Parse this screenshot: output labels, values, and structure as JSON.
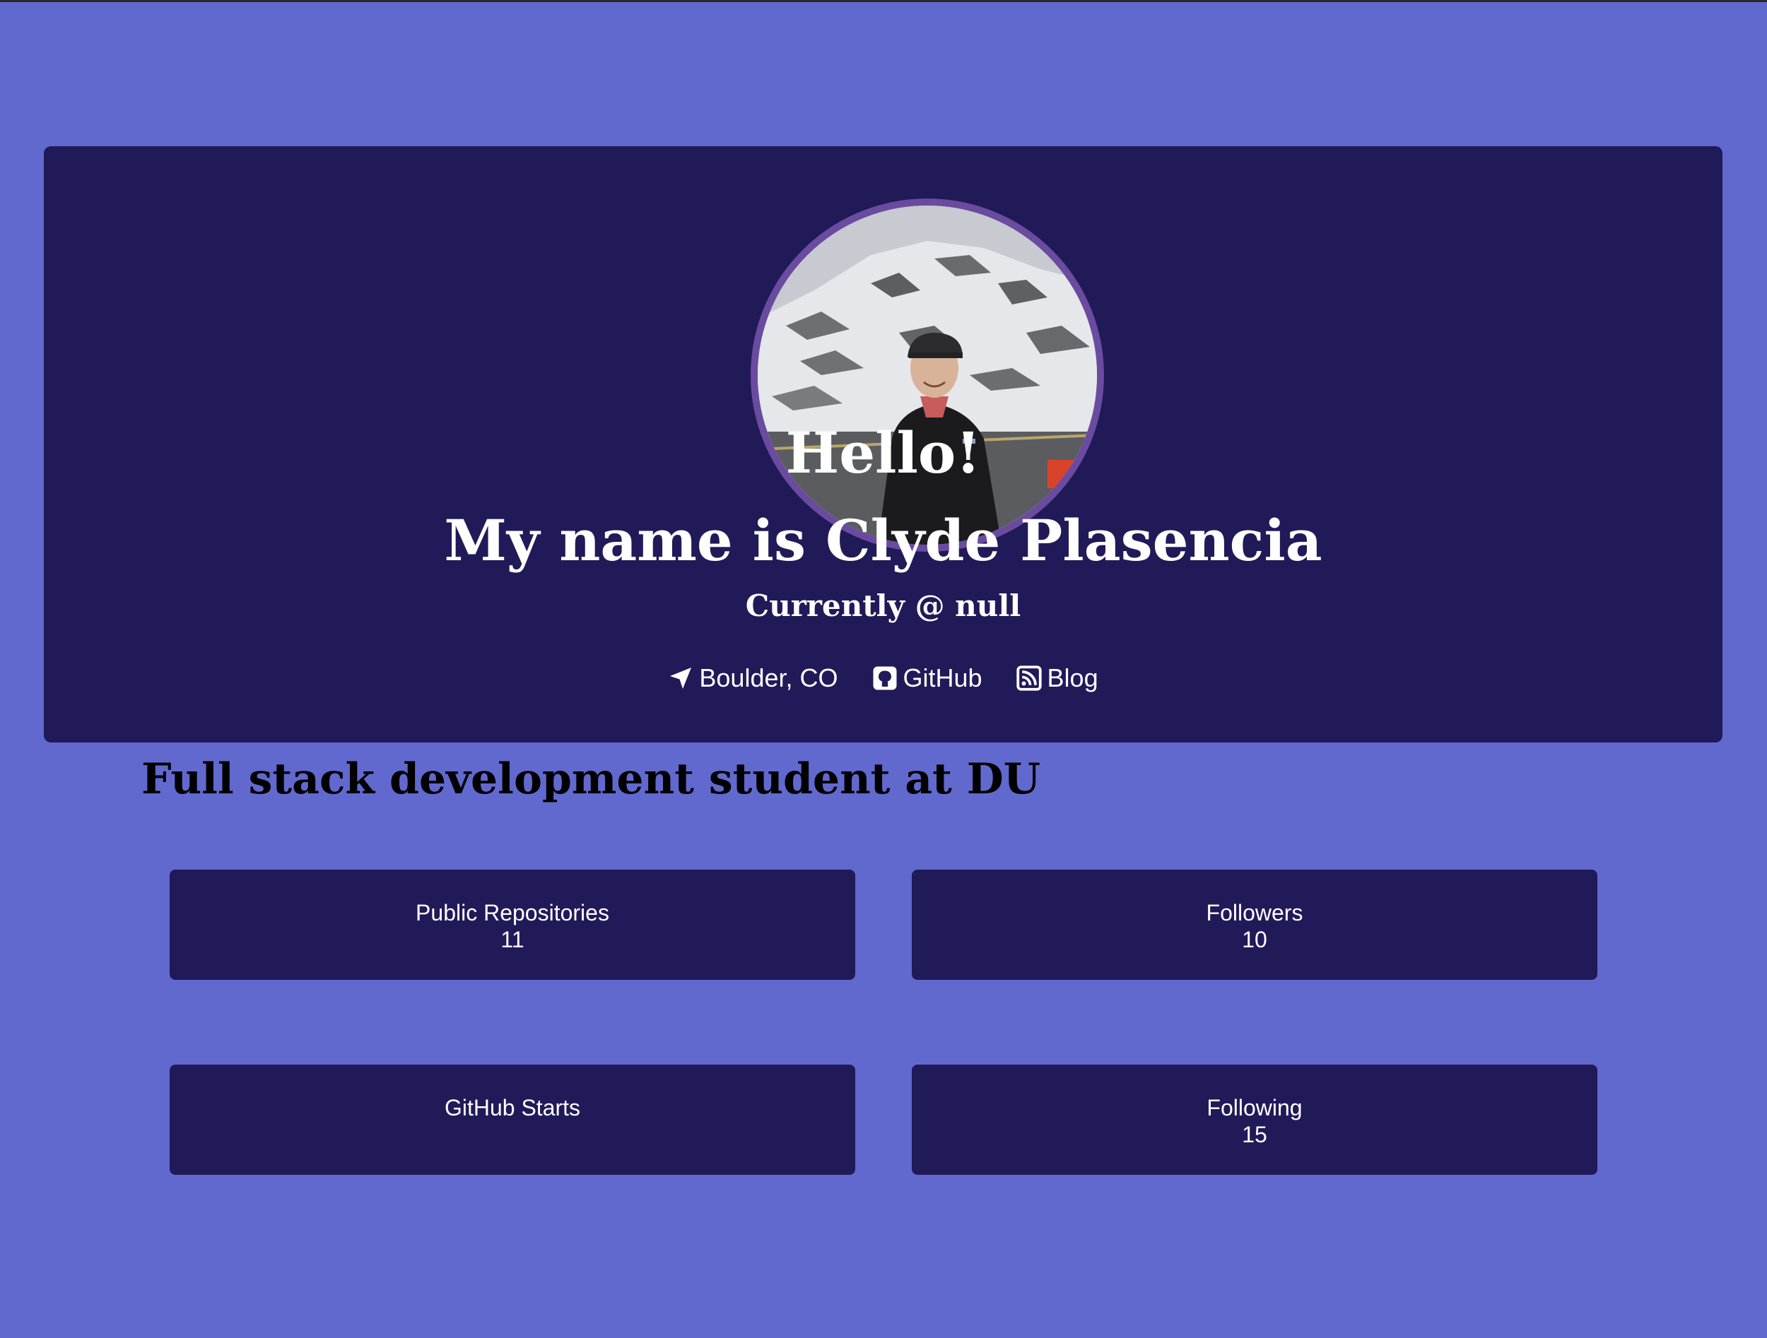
{
  "profile": {
    "greeting": "Hello!",
    "name_line": "My name is Clyde Plasencia",
    "currently": "Currently @ null",
    "bio": "Full stack development student at DU"
  },
  "links": {
    "location": "Boulder, CO",
    "github": "GitHub",
    "blog": "Blog"
  },
  "stats": {
    "public_repos_label": "Public Repositories",
    "public_repos_value": "11",
    "followers_label": "Followers",
    "followers_value": "10",
    "stars_label": "GitHub Starts",
    "stars_value": "",
    "following_label": "Following",
    "following_value": "15"
  },
  "icons": {
    "location": "location-arrow-icon",
    "github": "github-icon",
    "blog": "rss-icon",
    "avatar": "avatar-photo"
  },
  "colors": {
    "page_background": "#6169ce",
    "card_background": "#211a59",
    "avatar_border": "#6a4b9f",
    "text_light": "#ffffff",
    "text_dark": "#000000"
  }
}
